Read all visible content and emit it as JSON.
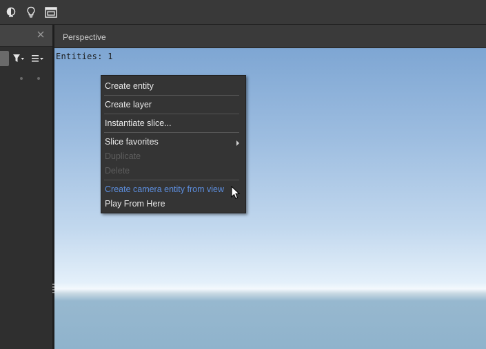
{
  "toolbar": {
    "icons": [
      "globe-icon",
      "lightbulb-icon",
      "window-layout-icon"
    ]
  },
  "left_panel": {
    "icons": [
      "close-icon",
      "filter-icon",
      "list-menu-icon"
    ]
  },
  "viewport": {
    "tab_label": "Perspective",
    "entities_label": "Entities: 1"
  },
  "context_menu": {
    "create_entity": "Create entity",
    "create_layer": "Create layer",
    "instantiate_slice": "Instantiate slice...",
    "slice_favorites": "Slice favorites",
    "duplicate": "Duplicate",
    "delete": "Delete",
    "create_camera": "Create camera entity from view",
    "play_from_here": "Play From Here"
  },
  "colors": {
    "hover_text": "#5d8fe0",
    "disabled_text": "#5e5e5e",
    "menu_bg": "#343434"
  }
}
